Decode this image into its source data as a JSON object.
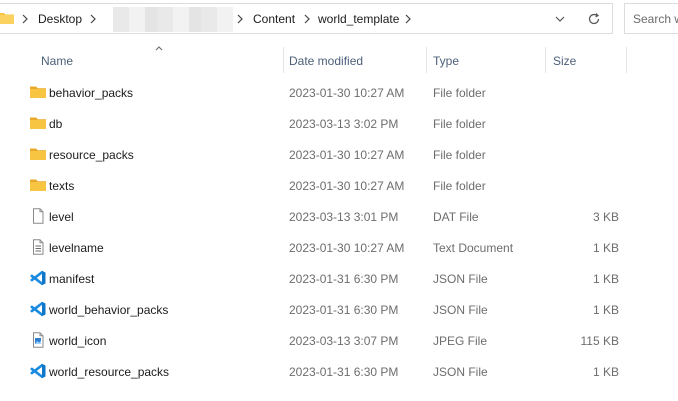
{
  "address_bar": {
    "crumbs": [
      "Desktop",
      "Content",
      "world_template"
    ]
  },
  "search": {
    "placeholder": "Search w"
  },
  "columns": {
    "name": "Name",
    "date": "Date modified",
    "type": "Type",
    "size": "Size"
  },
  "files": [
    {
      "name": "behavior_packs",
      "date": "2023-01-30 10:27 AM",
      "type": "File folder",
      "size": "",
      "icon": "folder-icon"
    },
    {
      "name": "db",
      "date": "2023-03-13 3:02 PM",
      "type": "File folder",
      "size": "",
      "icon": "folder-icon"
    },
    {
      "name": "resource_packs",
      "date": "2023-01-30 10:27 AM",
      "type": "File folder",
      "size": "",
      "icon": "folder-icon"
    },
    {
      "name": "texts",
      "date": "2023-01-30 10:27 AM",
      "type": "File folder",
      "size": "",
      "icon": "folder-icon"
    },
    {
      "name": "level",
      "date": "2023-03-13 3:01 PM",
      "type": "DAT File",
      "size": "3 KB",
      "icon": "document-icon"
    },
    {
      "name": "levelname",
      "date": "2023-01-30 10:27 AM",
      "type": "Text Document",
      "size": "1 KB",
      "icon": "text-document-icon"
    },
    {
      "name": "manifest",
      "date": "2023-01-31 6:30 PM",
      "type": "JSON File",
      "size": "1 KB",
      "icon": "vscode-icon"
    },
    {
      "name": "world_behavior_packs",
      "date": "2023-01-31 6:30 PM",
      "type": "JSON File",
      "size": "1 KB",
      "icon": "vscode-icon"
    },
    {
      "name": "world_icon",
      "date": "2023-03-13 3:07 PM",
      "type": "JPEG File",
      "size": "115 KB",
      "icon": "image-file-icon"
    },
    {
      "name": "world_resource_packs",
      "date": "2023-01-31 6:30 PM",
      "type": "JSON File",
      "size": "1 KB",
      "icon": "vscode-icon"
    }
  ],
  "colors": {
    "folder": "#f8c543",
    "vscode": "#0f76c8",
    "header_text": "#4c607a"
  }
}
